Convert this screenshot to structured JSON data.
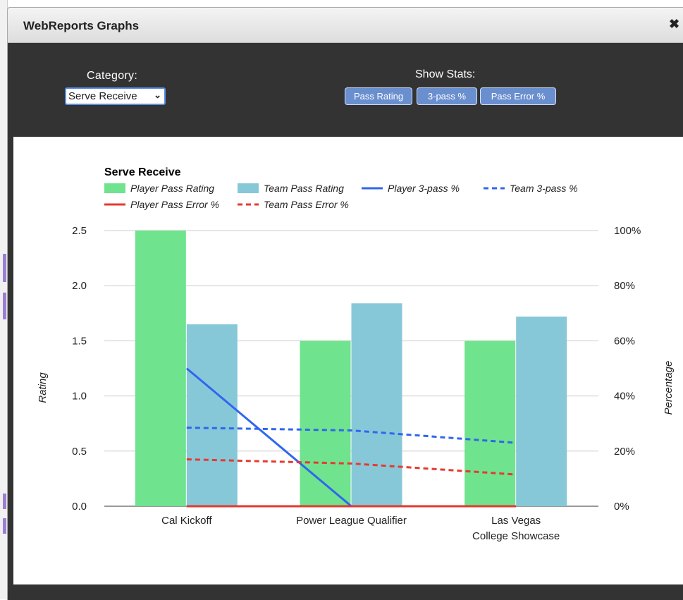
{
  "dialog": {
    "title": "WebReports Graphs",
    "close_icon": "close-icon"
  },
  "controls": {
    "category_label": "Category:",
    "category_value": "Serve Receive",
    "show_stats_label": "Show Stats:",
    "stat_buttons": [
      "Pass Rating",
      "3-pass %",
      "Pass Error %"
    ]
  },
  "colors": {
    "dialog_bg": "#333333",
    "player_pass_rating": "#6fe38e",
    "team_pass_rating": "#87c8d8",
    "three_pass": "#2f66f0",
    "pass_error": "#e53a2f",
    "stat_button": "#6a8fcf"
  },
  "chart_data": {
    "type": "bar",
    "title": "Serve Receive",
    "categories": [
      "Cal Kickoff",
      "Power League Qualifier",
      "Las Vegas College Showcase"
    ],
    "y_left": {
      "label": "Rating",
      "min": 0,
      "max": 2.5,
      "ticks": [
        "0.0",
        "0.5",
        "1.0",
        "1.5",
        "2.0",
        "2.5"
      ]
    },
    "y_right": {
      "label": "Percentage",
      "min": 0,
      "max": 100,
      "ticks": [
        "0%",
        "20%",
        "40%",
        "60%",
        "80%",
        "100%"
      ]
    },
    "grid": true,
    "legend_position": "top-left",
    "bar_series": [
      {
        "name": "Player Pass Rating",
        "values": [
          2.5,
          1.5,
          1.5
        ],
        "color": "#6fe38e",
        "axis": "left"
      },
      {
        "name": "Team Pass Rating",
        "values": [
          1.65,
          1.84,
          1.72
        ],
        "color": "#87c8d8",
        "axis": "left"
      }
    ],
    "line_series": [
      {
        "name": "Player 3-pass %",
        "values": [
          50,
          0,
          null
        ],
        "color": "#2f66f0",
        "style": "solid",
        "axis": "right"
      },
      {
        "name": "Team 3-pass %",
        "values": [
          28.5,
          27.5,
          23
        ],
        "color": "#2f66f0",
        "style": "dashed",
        "axis": "right"
      },
      {
        "name": "Player Pass Error %",
        "values": [
          0,
          0,
          0
        ],
        "color": "#e53a2f",
        "style": "solid",
        "axis": "right"
      },
      {
        "name": "Team Pass Error %",
        "values": [
          17,
          15.5,
          11.5
        ],
        "color": "#e53a2f",
        "style": "dashed",
        "axis": "right"
      }
    ]
  }
}
